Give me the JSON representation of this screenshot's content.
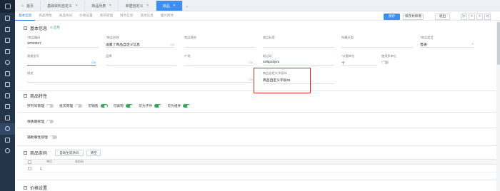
{
  "tabs": [
    {
      "label": "首页",
      "closable": false,
      "home": true
    },
    {
      "label": "基础资料自定义",
      "closable": true
    },
    {
      "label": "商品列表",
      "closable": true
    },
    {
      "label": "单据自定义",
      "closable": true
    },
    {
      "label": "商品",
      "closable": true,
      "active": true
    }
  ],
  "subtabs": [
    "基本信息",
    "商品特性",
    "商品条码",
    "价格设置",
    "库存管理",
    "财务信息",
    "其他信息",
    "图片附件"
  ],
  "toolbar": {
    "save_label": "保存",
    "save_new_label": "保存并新增",
    "exit_label": "退出",
    "nav": [
      "|<",
      "<",
      ">",
      ">|"
    ]
  },
  "basic": {
    "title": "基本信息",
    "status": "启用",
    "fields": {
      "code": {
        "label": "商品编码",
        "value": "SP00027"
      },
      "name": {
        "label": "商品名称",
        "value": "设置了商品自定义信息",
        "cn": "CN"
      },
      "short_name": {
        "label": "商品简称",
        "value": ""
      },
      "tag": {
        "label": "商品标签",
        "value": ""
      },
      "category": {
        "label": "所属分类",
        "value": ""
      },
      "type": {
        "label": "商品类型",
        "value": "普通"
      },
      "spec": {
        "label": "规格型号",
        "value": "",
        "cn": "CN"
      },
      "brand": {
        "label": "品牌",
        "value": ""
      },
      "origin": {
        "label": "产地",
        "value": "",
        "cn": "CN"
      },
      "mnemonic": {
        "label": "助记码",
        "value": "szlspzdyxx"
      },
      "unit": {
        "label": "计量单位",
        "value": "个"
      },
      "multi_unit": {
        "label": "使用多单位",
        "value": false
      },
      "desc": {
        "label": "描述",
        "value": "",
        "cn": "CN"
      },
      "custom1": {
        "label": "商品自定义字段01",
        "value": "商品自定义字段01"
      }
    }
  },
  "features": {
    "title": "商品特性",
    "row1": [
      {
        "label": "序列号管理",
        "on": false
      },
      {
        "label": "批次管理",
        "on": false
      },
      {
        "label": "可销售",
        "on": true
      },
      {
        "label": "可采购",
        "on": true
      },
      {
        "label": "可为子件",
        "on": true
      },
      {
        "label": "可为组件",
        "on": true
      }
    ],
    "row2": [
      {
        "label": "保质期管理",
        "on": false
      }
    ],
    "row3": [
      {
        "label": "辅助属性管理",
        "on": false
      }
    ]
  },
  "barcode": {
    "title": "商品条码",
    "auto_btn": "自动生成条码",
    "clear_btn": "清空",
    "columns": [
      "单位",
      "条形码"
    ],
    "rows": [
      {
        "index": "1",
        "unit": "",
        "barcode": ""
      }
    ]
  },
  "price": {
    "title": "价格设置"
  },
  "colors": {
    "sidebar": "#243449",
    "accent": "#3d8ef0",
    "toggle_on": "#3aa655",
    "highlight": "#e02c2c"
  }
}
